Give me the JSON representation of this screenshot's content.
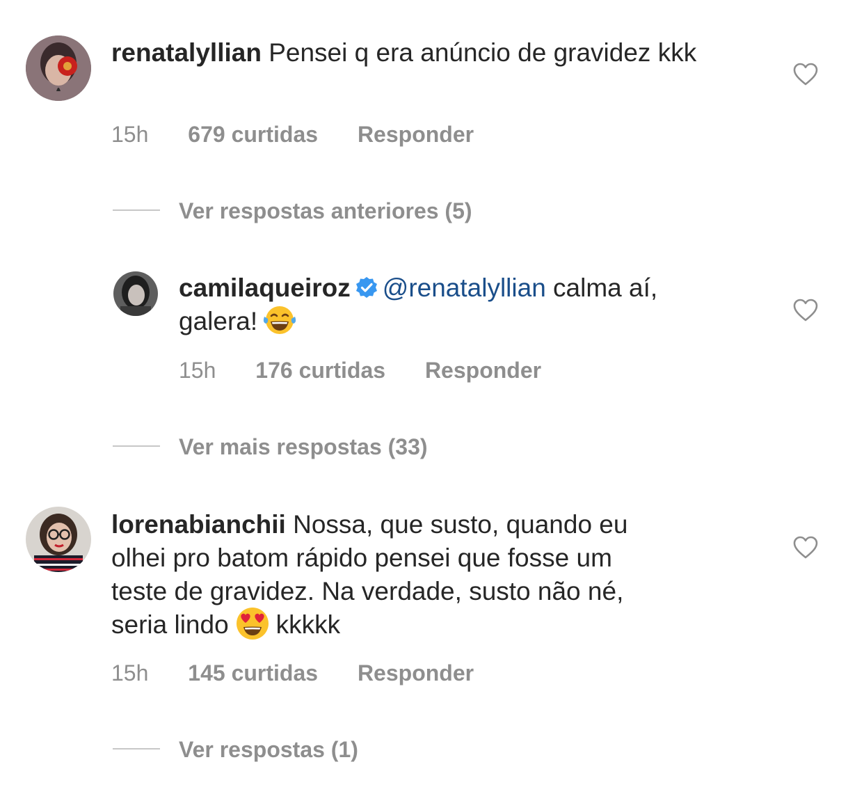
{
  "comments": [
    {
      "username": "renatalyllian",
      "text": "Pensei q era anúncio de gravidez kkk",
      "time": "15h",
      "likes": "679 curtidas",
      "reply": "Responder",
      "avatar_icon": "avatar-woman-red-flower"
    },
    {
      "username": "camilaqueiroz",
      "verified_icon": "verified-badge-icon",
      "mention": "@renatalyllian",
      "text_line1": " calma aí,",
      "text_line2": "galera!",
      "emoji": "laughing-tears-emoji",
      "time": "15h",
      "likes": "176 curtidas",
      "reply": "Responder",
      "avatar_icon": "avatar-woman-dark-hair"
    },
    {
      "username": "lorenabianchii",
      "text_line1": " Nossa, que susto, quando eu",
      "text_line2": "olhei pro batom rápido pensei que fosse um",
      "text_line3": "teste de gravidez. Na verdade, susto não né,",
      "text_line4a": "seria lindo",
      "emoji": "heart-eyes-emoji",
      "text_line4b": "kkkkk",
      "time": "15h",
      "likes": "145 curtidas",
      "reply": "Responder",
      "avatar_icon": "avatar-woman-glasses"
    }
  ],
  "reply_toggles": {
    "previous": "Ver respostas anteriores (5)",
    "more": "Ver mais respostas (33)",
    "view": "Ver respostas (1)"
  },
  "colors": {
    "text": "#262626",
    "secondary": "#8e8e8e",
    "mention": "#1a4e8a",
    "verified": "#3897f0"
  }
}
